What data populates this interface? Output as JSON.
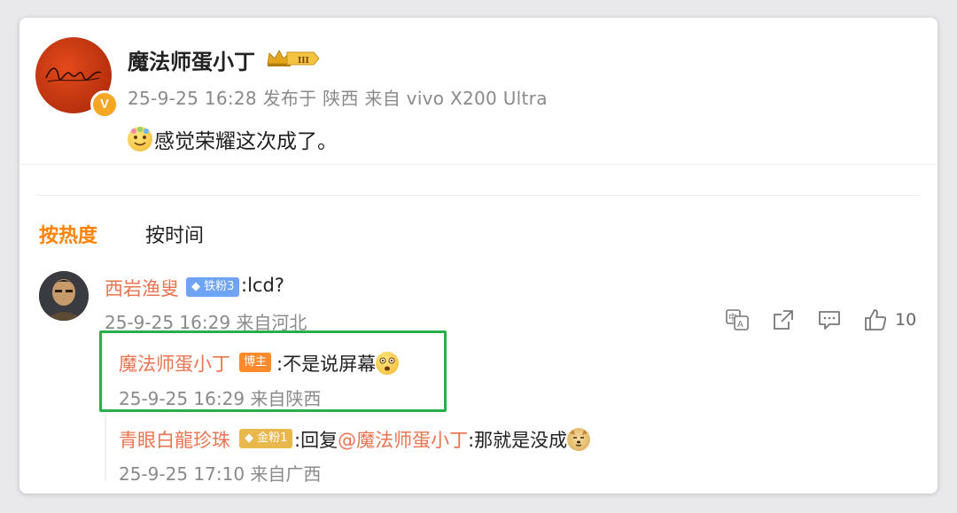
{
  "post": {
    "author": "魔法师蛋小丁",
    "vip_level": "III",
    "meta": "25-9-25 16:28 发布于 陕西 来自 vivo X200 Ultra",
    "text": "感觉荣耀这次成了。",
    "verified_mark": "V"
  },
  "sort": {
    "hot_label": "按热度",
    "time_label": "按时间"
  },
  "comment": {
    "author": "西岩渔叟",
    "badge": "铁粉3",
    "text": ":lcd?",
    "meta": "25-9-25 16:29 来自河北",
    "like_count": "10"
  },
  "replies": [
    {
      "author": "魔法师蛋小丁",
      "badge": "博主",
      "text": ":不是说屏幕",
      "meta": "25-9-25 16:29 来自陕西"
    },
    {
      "author": "青眼白龍珍珠",
      "badge": "金粉1",
      "text_prefix": ":回复",
      "mention": "@魔法师蛋小丁",
      "text_suffix": ":那就是没成",
      "meta": "25-9-25 17:10 来自广西"
    }
  ],
  "colors": {
    "accent_orange": "#ff8200",
    "name_link": "#eb7350",
    "highlight_box": "#27b04a",
    "meta_gray": "#8a8a8a"
  },
  "icons": [
    "translate-icon",
    "share-icon",
    "comment-icon",
    "like-icon",
    "emoji-icon",
    "dog-emoji-icon",
    "crown-icon",
    "verified-icon"
  ]
}
